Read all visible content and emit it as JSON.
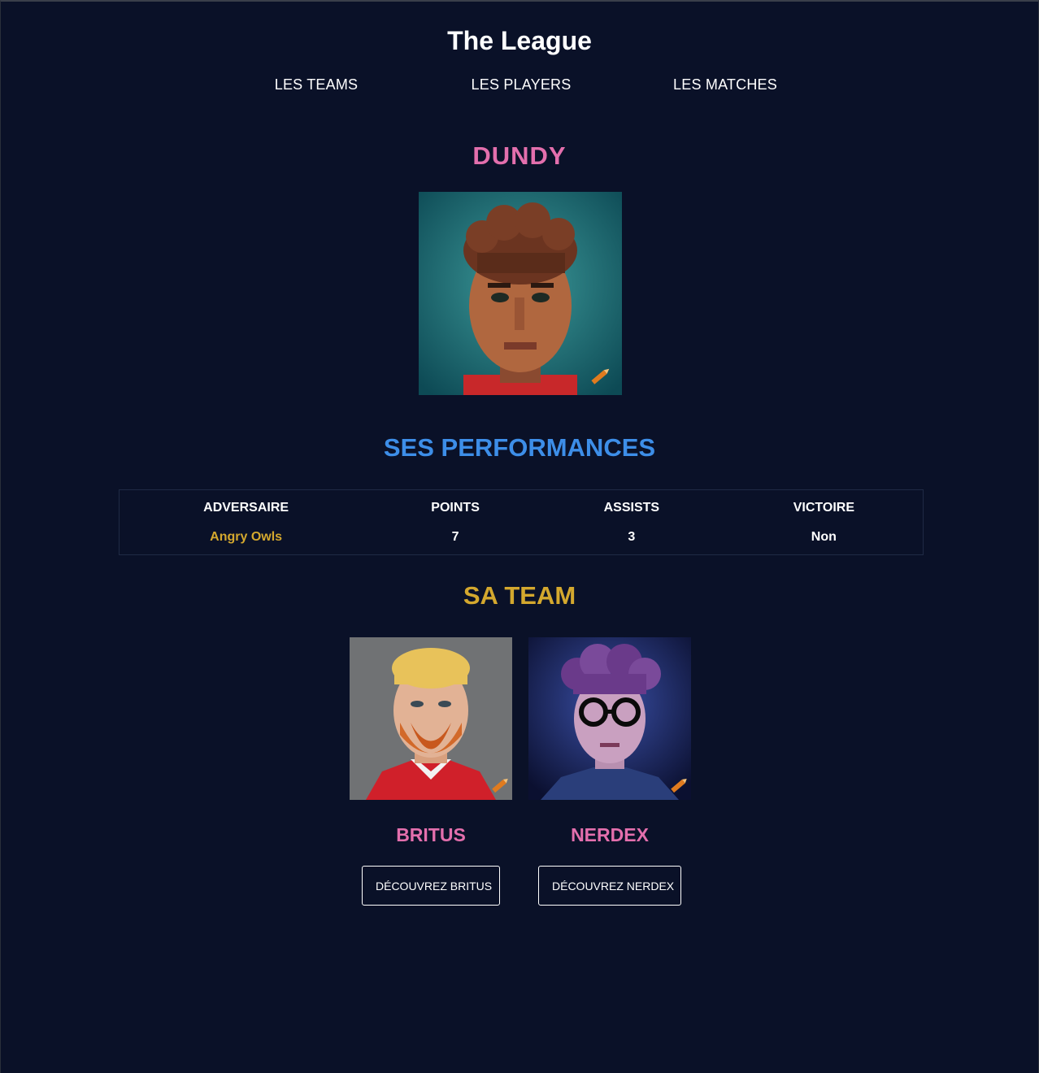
{
  "header": {
    "site_title": "The League",
    "nav": [
      {
        "label": "LES TEAMS"
      },
      {
        "label": "LES PLAYERS"
      },
      {
        "label": "LES MATCHES"
      }
    ]
  },
  "player": {
    "name": "DUNDY",
    "portrait_icon": "player-portrait"
  },
  "performances": {
    "title": "SES PERFORMANCES",
    "columns": [
      "ADVERSAIRE",
      "POINTS",
      "ASSISTS",
      "VICTOIRE"
    ],
    "rows": [
      {
        "adversaire": "Angry Owls",
        "points": "7",
        "assists": "3",
        "victoire": "Non"
      }
    ]
  },
  "team": {
    "title": "SA TEAM",
    "members": [
      {
        "name": "BRITUS",
        "button": "DÉCOUVREZ BRITUS"
      },
      {
        "name": "NERDEX",
        "button": "DÉCOUVREZ NERDEX"
      }
    ]
  },
  "colors": {
    "background": "#0a1128",
    "player_name": "#e36fad",
    "performances_title": "#3d8ee8",
    "team_title": "#d4a82e",
    "opponent_link": "#d4a82e"
  }
}
